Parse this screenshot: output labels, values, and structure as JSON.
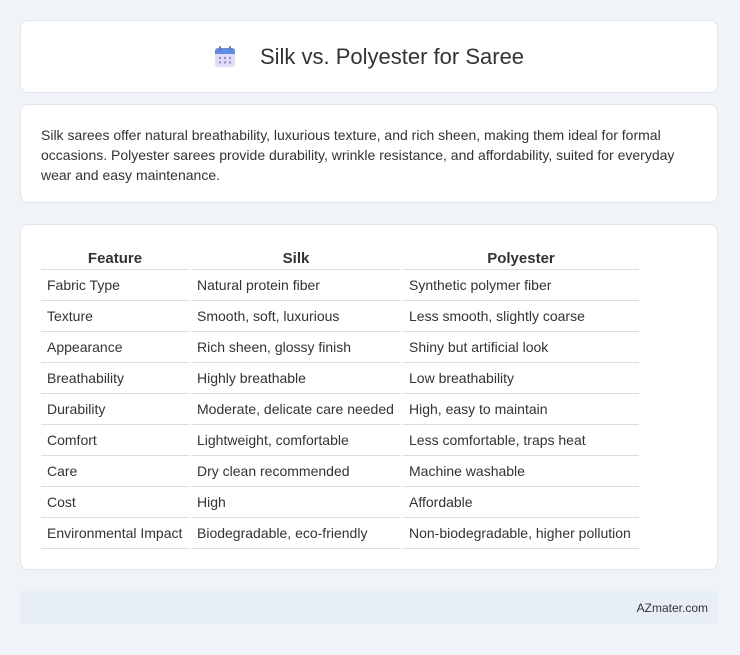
{
  "header": {
    "icon": "calendar-icon",
    "title": "Silk vs. Polyester for Saree"
  },
  "description": "Silk sarees offer natural breathability, luxurious texture, and rich sheen, making them ideal for formal occasions. Polyester sarees provide durability, wrinkle resistance, and affordability, suited for everyday wear and easy maintenance.",
  "table": {
    "headers": [
      "Feature",
      "Silk",
      "Polyester"
    ],
    "rows": [
      [
        "Fabric Type",
        "Natural protein fiber",
        "Synthetic polymer fiber"
      ],
      [
        "Texture",
        "Smooth, soft, luxurious",
        "Less smooth, slightly coarse"
      ],
      [
        "Appearance",
        "Rich sheen, glossy finish",
        "Shiny but artificial look"
      ],
      [
        "Breathability",
        "Highly breathable",
        "Low breathability"
      ],
      [
        "Durability",
        "Moderate, delicate care needed",
        "High, easy to maintain"
      ],
      [
        "Comfort",
        "Lightweight, comfortable",
        "Less comfortable, traps heat"
      ],
      [
        "Care",
        "Dry clean recommended",
        "Machine washable"
      ],
      [
        "Cost",
        "High",
        "Affordable"
      ],
      [
        "Environmental Impact",
        "Biodegradable, eco-friendly",
        "Non-biodegradable, higher pollution"
      ]
    ]
  },
  "footer": {
    "brand": "AZmater.com"
  }
}
